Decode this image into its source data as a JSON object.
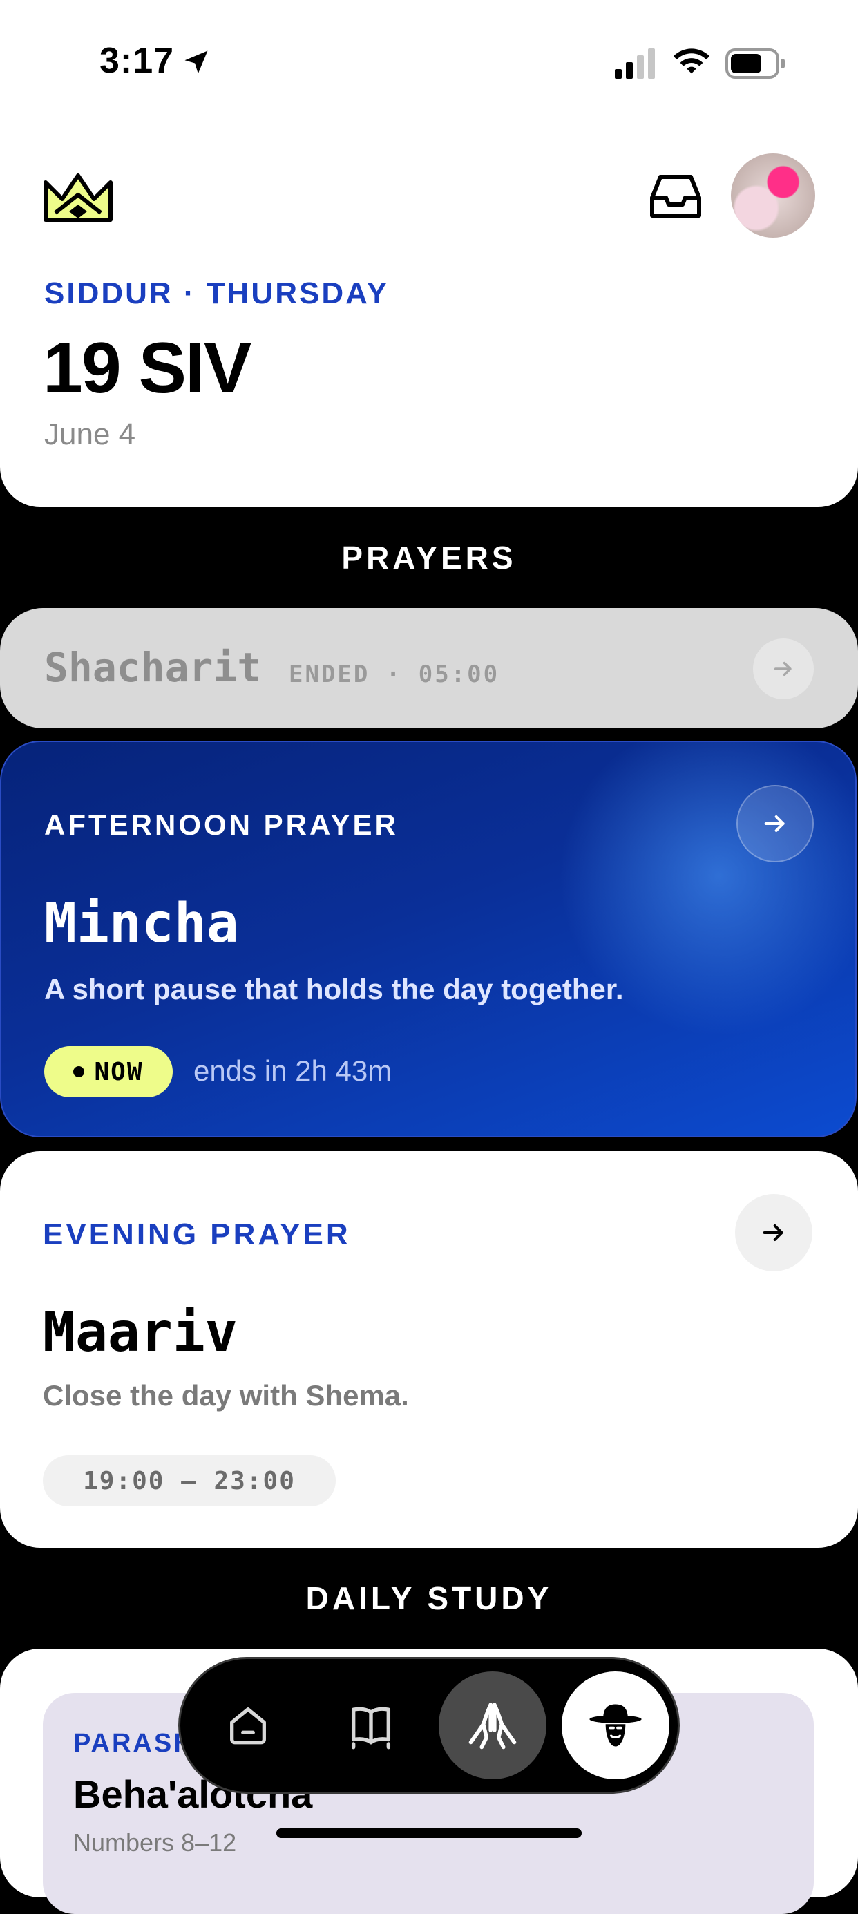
{
  "status_bar": {
    "time": "3:17"
  },
  "header": {
    "section_label": "SIDDUR · THURSDAY",
    "hebrew_date": "19 SIV",
    "gregorian_date": "June 4"
  },
  "sections": {
    "prayers": "PRAYERS",
    "daily_study": "DAILY STUDY"
  },
  "prayers": {
    "shacharit": {
      "name": "Shacharit",
      "meta": "ENDED · 05:00"
    },
    "mincha": {
      "label": "AFTERNOON PRAYER",
      "name": "Mincha",
      "description": "A short pause that holds the day together.",
      "badge": "NOW",
      "ends": "ends in 2h 43m"
    },
    "maariv": {
      "label": "EVENING PRAYER",
      "name": "Maariv",
      "description": "Close the day with Shema.",
      "time_range": "19:00 – 23:00"
    }
  },
  "study": {
    "parasha_label": "PARASHA",
    "parasha_name": "Beha'alotcha",
    "parasha_ref": "Numbers 8–12"
  },
  "nav": {
    "items": [
      {
        "icon": "home-icon"
      },
      {
        "icon": "book-icon"
      },
      {
        "icon": "praying-hands-icon",
        "active": true
      },
      {
        "icon": "rabbi-profile-icon"
      }
    ]
  },
  "colors": {
    "accent_blue": "#1a3fbf",
    "now_badge": "#eefc8a",
    "card_blue": "#0a2f98"
  }
}
